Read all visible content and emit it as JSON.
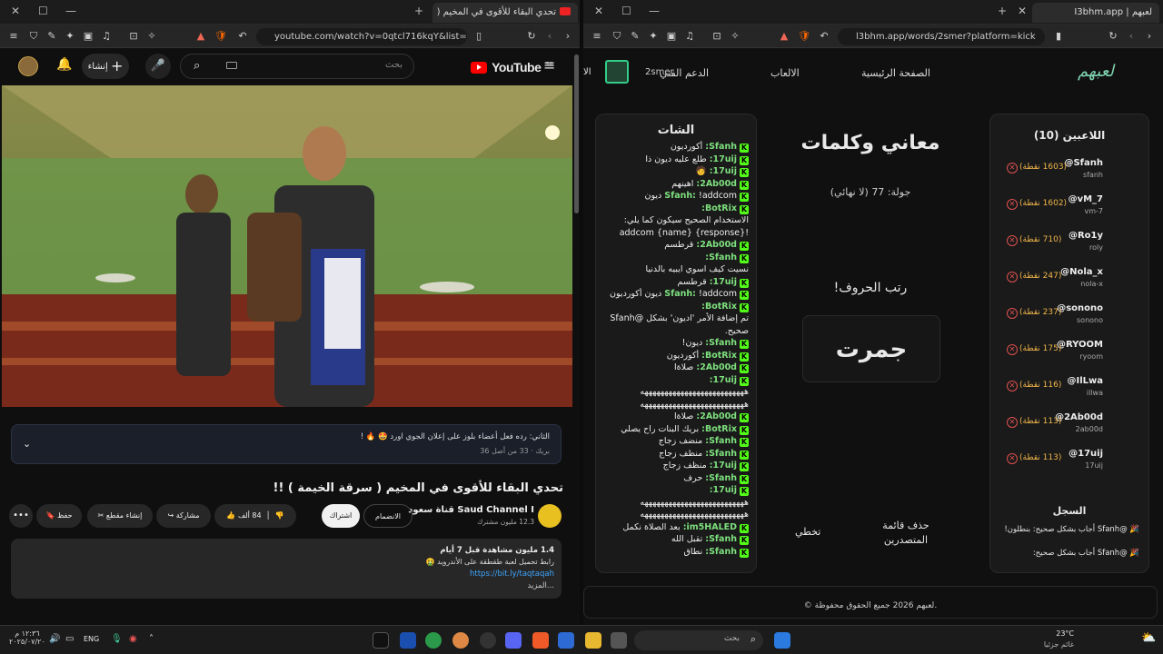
{
  "left": {
    "tab_title": "تحدي البقاء للأقوى في المخيم (",
    "url": "youtube.com/watch?v=0qtcl716kqY&list=...",
    "yt": {
      "create_label": "إنشاء",
      "search_placeholder": "بحث",
      "logo": "YouTube",
      "region": "SA"
    },
    "pinned": {
      "line1": "الثاني: رده فعل أعضاء بلوز على إعلان الجوي اورد 🤩 🔥 !",
      "line2": "بريك · 33 من أصل 36"
    },
    "video_title": "تحدي البقاء للأقوى في المخيم ( سرقة الخيمة ) !!",
    "channel": {
      "name": "Saud Channel I قناة سعود",
      "subs": "12.3 مليون مشترك",
      "join": "الانضمام",
      "subscribe": "اشتراك"
    },
    "actions": {
      "likes": "84 ألف",
      "share": "مشاركة",
      "clip": "إنشاء مقطع",
      "save": "حفظ"
    },
    "desc": {
      "line1": "1.4 مليون مشاهدة  قبل 7 أيام",
      "line2": "رابط تحميل لعبة طقطقة على الأندرويد 🤮",
      "link": "https://bit.ly/taqtaqah",
      "more": "...المزيد"
    }
  },
  "right": {
    "tab_title": "لعبهم | I3bhm.app",
    "url": "l3bhm.app/words/2smer?platform=kick",
    "nav": {
      "logo": "لعبهم",
      "home": "الصفحة الرئيسية",
      "games": "الالعاب",
      "support": "الدعم الفني",
      "user": "2smer",
      "extra": "الا"
    },
    "players_title": "اللاعبين (10)",
    "players": [
      {
        "name": "@Sfanh",
        "sub": "sfanh",
        "pts": "(1603 نقطة)"
      },
      {
        "name": "@vM_7",
        "sub": "vm-7",
        "pts": "(1602 نقطة)"
      },
      {
        "name": "@Ro1y",
        "sub": "roly",
        "pts": "(710 نقطة)"
      },
      {
        "name": "@Nola_x",
        "sub": "nola-x",
        "pts": "(247 نقطة)"
      },
      {
        "name": "@sonono",
        "sub": "sonono",
        "pts": "(237 نقطة)"
      },
      {
        "name": "@RYOOM",
        "sub": "ryoom",
        "pts": "(175 نقطة)"
      },
      {
        "name": "@IlLwa",
        "sub": "illwa",
        "pts": "(116 نقطة)"
      },
      {
        "name": "@2Ab00d",
        "sub": "2ab00d",
        "pts": "(113 نقطة)"
      },
      {
        "name": "@17uij",
        "sub": "17uij",
        "pts": "(113 نقطة)"
      }
    ],
    "log_title": "السجل",
    "log": [
      "🎉 @Sfanh أجاب بشكل صحيح: بنطلون!",
      "🎉 @Sfanh أجاب بشكل صحيح:"
    ],
    "game": {
      "title": "معاني وكلمات",
      "round": "جولة: 77 (لا نهائي)",
      "prompt": "رتب الحروف!",
      "word": "جمرت",
      "clear_btn": "حذف قائمة المتصدرين",
      "skip_btn": "تخطي"
    },
    "chat_title": "الشات",
    "chat": [
      {
        "u": "Sfanh:",
        "t": "أكورديون"
      },
      {
        "u": "17uij:",
        "t": "طلع عليه ديون ذا"
      },
      {
        "u": "17uij:",
        "t": "🧑"
      },
      {
        "u": "2Ab00d:",
        "t": "اهينهم"
      },
      {
        "u": "Sfanh:",
        "t": "!addcom ديون"
      },
      {
        "u": "BotRix:",
        "t": ""
      },
      {
        "u": "",
        "t": "الاستخدام الصحيح سيكون كما يلي:"
      },
      {
        "u": "",
        "t": "!addcom {name} {response}"
      },
      {
        "u": "2Ab00d:",
        "t": "قرطسم"
      },
      {
        "u": "Sfanh:",
        "t": ""
      },
      {
        "u": "",
        "t": "نسيت كيف اسوي ايبيه بالدنيا"
      },
      {
        "u": "17uij:",
        "t": "قرطسم"
      },
      {
        "u": "Sfanh:",
        "t": "!addcom ديون أكورديون"
      },
      {
        "u": "BotRix:",
        "t": ""
      },
      {
        "u": "",
        "t": "تم إضافة الأمر 'اديون' بشكل @Sfanh"
      },
      {
        "u": "",
        "t": "صحيح."
      },
      {
        "u": "Sfanh:",
        "t": "ديون!"
      },
      {
        "u": "BotRix:",
        "t": "أكورديون"
      },
      {
        "u": "2Ab00d:",
        "t": "صلاةا"
      },
      {
        "u": "17uij:",
        "t": ""
      },
      {
        "u": "",
        "t": "ههههههههههههههههههههههههههه"
      },
      {
        "u": "",
        "t": "ههههههههههههههههههههههههههه"
      },
      {
        "u": "2Ab00d:",
        "t": "صلاةا"
      },
      {
        "u": "BotRix:",
        "t": "بريك البنات راح يصلي"
      },
      {
        "u": "Sfanh:",
        "t": "منضف زجاج"
      },
      {
        "u": "Sfanh:",
        "t": "منظف زجاج"
      },
      {
        "u": "17uij:",
        "t": "منظف زجاج"
      },
      {
        "u": "Sfanh:",
        "t": "حرف"
      },
      {
        "u": "17uij:",
        "t": ""
      },
      {
        "u": "",
        "t": "ههههههههههههههههههههههههههه"
      },
      {
        "u": "",
        "t": "ههههههههههههههههههههههههههه"
      },
      {
        "u": "im5HALED:",
        "t": "بعد الصلاة نكمل"
      },
      {
        "u": "Sfanh:",
        "t": "تقبل الله"
      },
      {
        "u": "Sfanh:",
        "t": "نطاق"
      }
    ],
    "footer": "© لعبهم 2026 جميع الحقوق محفوظة."
  },
  "taskbar": {
    "weather_temp": "23°C",
    "weather_desc": "غائم جزئيا",
    "search": "بحث",
    "lang": "ENG",
    "time": "١٢:٣٦ م",
    "date": "٢٠٢٥/٠٧/٢٠"
  }
}
